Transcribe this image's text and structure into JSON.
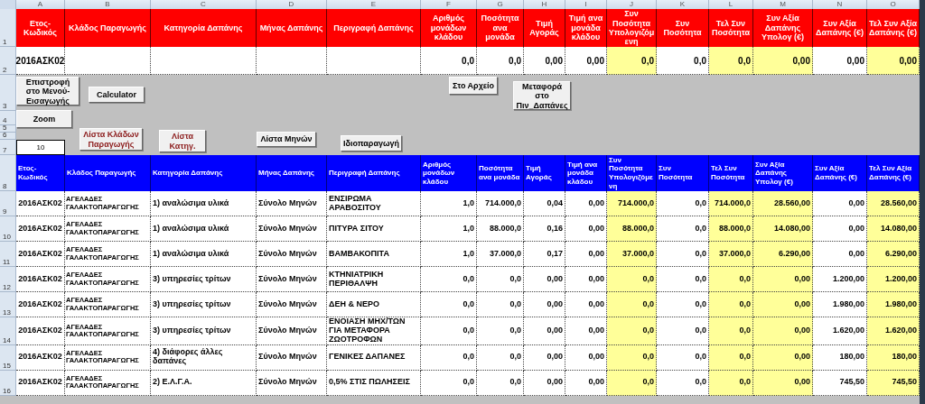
{
  "column_letters": [
    "A",
    "B",
    "C",
    "D",
    "E",
    "F",
    "G",
    "H",
    "I",
    "J",
    "K",
    "L",
    "M",
    "N",
    "O"
  ],
  "input_table": {
    "header_row_number": "1",
    "columns": [
      {
        "label": "Ετος-Κωδικός",
        "highlighted": false
      },
      {
        "label": "Κλάδος Παραγωγής",
        "highlighted": false
      },
      {
        "label": "Κατηγορία Δαπάνης",
        "highlighted": false
      },
      {
        "label": "Μήνας Δαπάνης",
        "highlighted": false
      },
      {
        "label": "Περιγραφή Δαπάνης",
        "highlighted": false
      },
      {
        "label": "Αριθμός μονάδων κλάδου",
        "highlighted": false
      },
      {
        "label": "Ποσότητα ανα μονάδα",
        "highlighted": false
      },
      {
        "label": "Τιμή Αγοράς",
        "highlighted": false
      },
      {
        "label": "Τιμή ανα μονάδα κλάδου",
        "highlighted": false
      },
      {
        "label": "Συν Ποσότητα Υπολογιζόμενη",
        "highlighted": true
      },
      {
        "label": "Συν Ποσότητα",
        "highlighted": false
      },
      {
        "label": "Τελ Συν Ποσότητα",
        "highlighted": true
      },
      {
        "label": "Συν Αξία Δαπάνης Υπολογ (€)",
        "highlighted": true
      },
      {
        "label": "Συν Αξία Δαπάνης (€)",
        "highlighted": false
      },
      {
        "label": "Τελ Συν Αξία Δαπάνης (€)",
        "highlighted": true
      }
    ],
    "row": {
      "number": "2",
      "cells": [
        "2016ΑΣΚ02",
        "",
        "",
        "",
        "",
        "0,0",
        "0,0",
        "0,00",
        "0,00",
        "0,0",
        "0,0",
        "0,0",
        "0,00",
        "0,00",
        "0,00"
      ]
    }
  },
  "controls": {
    "row_numbers": [
      "3",
      "4",
      "5",
      "6",
      "7"
    ],
    "zoom_value": "10",
    "buttons": [
      {
        "label": "Επιστροφή στο Μενού-Εισαγωγής",
        "color": "#000000"
      },
      {
        "label": "Calculator",
        "color": "#000000"
      },
      {
        "label": "Zoom",
        "color": "#000000"
      },
      {
        "label": "Λίστα Κλάδων Παραγωγής",
        "color": "#8b1a1a"
      },
      {
        "label": "Λίστα Κατηγ.",
        "color": "#8b1a1a"
      },
      {
        "label": "Λίστα Μηνών",
        "color": "#000000"
      },
      {
        "label": "Ιδιοπαραγωγή",
        "color": "#000000"
      },
      {
        "label": "Στο Αρχείο",
        "color": "#000000"
      },
      {
        "label": "Μεταφορά στο Πιν_Δαπάνες",
        "color": "#000000"
      }
    ]
  },
  "data_table": {
    "header_row_number": "8",
    "columns": [
      {
        "label": "Ετος-Κωδικός",
        "highlighted": false
      },
      {
        "label": "Κλάδος Παραγωγής",
        "highlighted": false
      },
      {
        "label": "Κατηγορία Δαπάνης",
        "highlighted": false
      },
      {
        "label": "Μήνας Δαπάνης",
        "highlighted": false
      },
      {
        "label": "Περιγραφή Δαπάνης",
        "highlighted": false
      },
      {
        "label": "Αριθμός μονάδων κλάδου",
        "highlighted": false
      },
      {
        "label": "Ποσότητα ανα μονάδα",
        "highlighted": false
      },
      {
        "label": "Τιμή Αγοράς",
        "highlighted": false
      },
      {
        "label": "Τιμή ανα μονάδα κλάδου",
        "highlighted": false
      },
      {
        "label": "Συν Ποσότητα Υπολογιζόμενη",
        "highlighted": true
      },
      {
        "label": "Συν Ποσότητα",
        "highlighted": false
      },
      {
        "label": "Τελ Συν Ποσότητα",
        "highlighted": true
      },
      {
        "label": "Συν Αξία Δαπάνης Υπολογ (€)",
        "highlighted": true
      },
      {
        "label": "Συν Αξία Δαπάνης (€)",
        "highlighted": false
      },
      {
        "label": "Τελ Συν Αξία Δαπάνης (€)",
        "highlighted": true
      }
    ],
    "rows": [
      {
        "number": "9",
        "cells": [
          "2016ΑΣΚ02",
          "ΑΓΕΛΑΔΕΣ ΓΑΛΑΚΤΟΠΑΡΑΓΩΓΗΣ",
          "1) αναλώσιμα υλικά",
          "Σύνολο Μηνών",
          "ΕΝΣΙΡΩΜΑ ΑΡΑΒΟΣΙΤΟΥ",
          "1,0",
          "714.000,0",
          "0,04",
          "0,00",
          "714.000,0",
          "0,0",
          "714.000,0",
          "28.560,00",
          "0,00",
          "28.560,00"
        ]
      },
      {
        "number": "10",
        "cells": [
          "2016ΑΣΚ02",
          "ΑΓΕΛΑΔΕΣ ΓΑΛΑΚΤΟΠΑΡΑΓΩΓΗΣ",
          "1) αναλώσιμα υλικά",
          "Σύνολο Μηνών",
          "ΠΙΤΥΡΑ ΣΙΤΟΥ",
          "1,0",
          "88.000,0",
          "0,16",
          "0,00",
          "88.000,0",
          "0,0",
          "88.000,0",
          "14.080,00",
          "0,00",
          "14.080,00"
        ]
      },
      {
        "number": "11",
        "cells": [
          "2016ΑΣΚ02",
          "ΑΓΕΛΑΔΕΣ ΓΑΛΑΚΤΟΠΑΡΑΓΩΓΗΣ",
          "1) αναλώσιμα υλικά",
          "Σύνολο Μηνών",
          "ΒΑΜΒΑΚΟΠΙΤΑ",
          "1,0",
          "37.000,0",
          "0,17",
          "0,00",
          "37.000,0",
          "0,0",
          "37.000,0",
          "6.290,00",
          "0,00",
          "6.290,00"
        ]
      },
      {
        "number": "12",
        "cells": [
          "2016ΑΣΚ02",
          "ΑΓΕΛΑΔΕΣ ΓΑΛΑΚΤΟΠΑΡΑΓΩΓΗΣ",
          "3) υπηρεσίες τρίτων",
          "Σύνολο Μηνών",
          "ΚΤΗΝΙΑΤΡΙΚΗ ΠΕΡΙΘΑΛΨΗ",
          "0,0",
          "0,0",
          "0,00",
          "0,00",
          "0,0",
          "0,0",
          "0,0",
          "0,00",
          "1.200,00",
          "1.200,00"
        ]
      },
      {
        "number": "13",
        "cells": [
          "2016ΑΣΚ02",
          "ΑΓΕΛΑΔΕΣ ΓΑΛΑΚΤΟΠΑΡΑΓΩΓΗΣ",
          "3) υπηρεσίες τρίτων",
          "Σύνολο Μηνών",
          "ΔΕΗ & ΝΕΡΟ",
          "0,0",
          "0,0",
          "0,00",
          "0,00",
          "0,0",
          "0,0",
          "0,0",
          "0,00",
          "1.980,00",
          "1.980,00"
        ]
      },
      {
        "number": "14",
        "cells": [
          "2016ΑΣΚ02",
          "ΑΓΕΛΑΔΕΣ ΓΑΛΑΚΤΟΠΑΡΑΓΩΓΗΣ",
          "3) υπηρεσίες τρίτων",
          "Σύνολο Μηνών",
          "ΕΝΟΙΑΣΗ ΜΗΧ/ΤΩΝ ΓΙΑ ΜΕΤΑΦΟΡΑ ΖΩΟΤΡΟΦΩΝ",
          "0,0",
          "0,0",
          "0,00",
          "0,00",
          "0,0",
          "0,0",
          "0,0",
          "0,00",
          "1.620,00",
          "1.620,00"
        ]
      },
      {
        "number": "15",
        "cells": [
          "2016ΑΣΚ02",
          "ΑΓΕΛΑΔΕΣ ΓΑΛΑΚΤΟΠΑΡΑΓΩΓΗΣ",
          "4) διάφορες άλλες δαπάνες",
          "Σύνολο Μηνών",
          "ΓΕΝΙΚΕΣ ΔΑΠΑΝΕΣ",
          "0,0",
          "0,0",
          "0,00",
          "0,00",
          "0,0",
          "0,0",
          "0,0",
          "0,00",
          "180,00",
          "180,00"
        ]
      },
      {
        "number": "16",
        "cells": [
          "2016ΑΣΚ02",
          "ΑΓΕΛΑΔΕΣ ΓΑΛΑΚΤΟΠΑΡΑΓΩΓΗΣ",
          "2) Ε.Λ.Γ.Α.",
          "Σύνολο Μηνών",
          "0,5% ΣΤΙΣ ΠΩΛΗΣΕΙΣ",
          "0,0",
          "0,0",
          "0,00",
          "0,00",
          "0,0",
          "0,0",
          "0,0",
          "0,00",
          "745,50",
          "745,50"
        ]
      }
    ]
  }
}
